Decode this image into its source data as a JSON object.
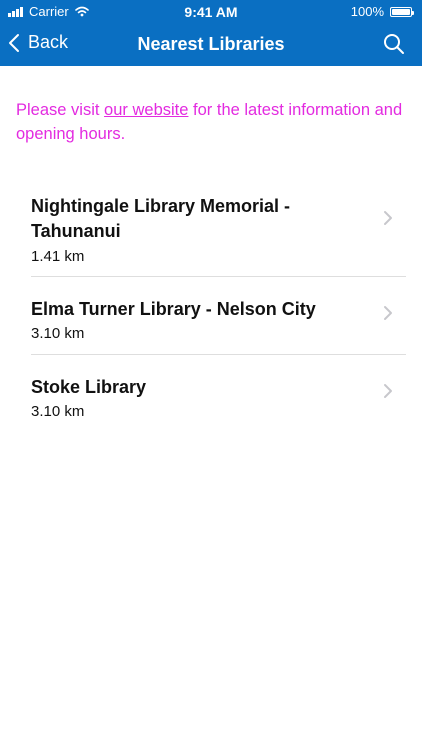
{
  "status_bar": {
    "carrier": "Carrier",
    "time": "9:41 AM",
    "battery": "100%"
  },
  "nav": {
    "back_label": "Back",
    "title": "Nearest Libraries",
    "search_icon": "search-icon"
  },
  "notice": {
    "before": "Please visit ",
    "link_text": "our website",
    "after": " for the latest information and opening hours."
  },
  "libraries": [
    {
      "name": "Nightingale Library Memorial - Tahunanui",
      "distance": "1.41 km"
    },
    {
      "name": "Elma Turner Library - Nelson City",
      "distance": "3.10 km"
    },
    {
      "name": "Stoke Library",
      "distance": "3.10 km"
    }
  ],
  "colors": {
    "nav_bar": "#0a6fc2",
    "notice_text": "#e32be0",
    "divider": "#dedede",
    "chevron": "#c7c7cc"
  }
}
